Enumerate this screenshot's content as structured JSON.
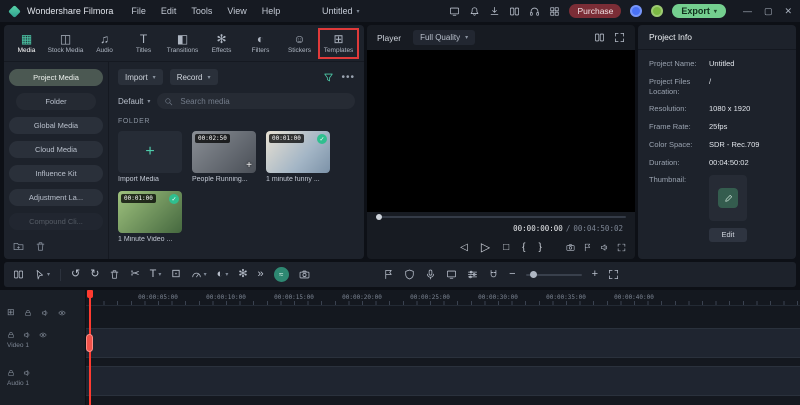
{
  "titlebar": {
    "app_name": "Wondershare Filmora",
    "menus": [
      "File",
      "Edit",
      "Tools",
      "View",
      "Help"
    ],
    "project_title": "Untitled",
    "purchase_label": "Purchase",
    "export_label": "Export"
  },
  "tabs": {
    "items": [
      {
        "label": "Media",
        "glyph": "▦"
      },
      {
        "label": "Stock Media",
        "glyph": "◫"
      },
      {
        "label": "Audio",
        "glyph": "♫"
      },
      {
        "label": "Titles",
        "glyph": "T"
      },
      {
        "label": "Transitions",
        "glyph": "◧"
      },
      {
        "label": "Effects",
        "glyph": "✻"
      },
      {
        "label": "Filters",
        "glyph": "◐"
      },
      {
        "label": "Stickers",
        "glyph": "☺"
      },
      {
        "label": "Templates",
        "glyph": "⊞"
      }
    ]
  },
  "sidebar": {
    "items": [
      {
        "label": "Project Media"
      },
      {
        "label": "Folder"
      },
      {
        "label": "Global Media"
      },
      {
        "label": "Cloud Media"
      },
      {
        "label": "Influence Kit"
      },
      {
        "label": "Adjustment La..."
      },
      {
        "label": "Compound Cli..."
      }
    ]
  },
  "media": {
    "import_label": "Import",
    "record_label": "Record",
    "sort_label": "Default",
    "search_placeholder": "Search media",
    "folder_label": "FOLDER",
    "tiles": [
      {
        "name": "Import Media"
      },
      {
        "name": "People Running...",
        "duration": "00:02:50"
      },
      {
        "name": "1 minute funny ...",
        "duration": "00:01:00"
      },
      {
        "name": "1 Minute Video ...",
        "duration": "00:01:00"
      }
    ]
  },
  "player": {
    "label": "Player",
    "quality": "Full Quality",
    "time_current": "00:00:00:00",
    "time_separator": "/",
    "time_total": "00:04:50:02"
  },
  "project_info": {
    "title": "Project Info",
    "fields": [
      {
        "label": "Project Name:",
        "value": "Untitled"
      },
      {
        "label": "Project Files Location:",
        "value": "/"
      },
      {
        "label": "Resolution:",
        "value": "1080 x 1920"
      },
      {
        "label": "Frame Rate:",
        "value": "25fps"
      },
      {
        "label": "Color Space:",
        "value": "SDR - Rec.709"
      },
      {
        "label": "Duration:",
        "value": "00:04:50:02"
      },
      {
        "label": "Thumbnail:",
        "value": ""
      }
    ],
    "edit_label": "Edit"
  },
  "timeline": {
    "ruler_labels": [
      "00:00:05:00",
      "00:00:10:00",
      "00:00:15:00",
      "00:00:20:00",
      "00:00:25:00",
      "00:00:30:00",
      "00:00:35:00",
      "00:00:40:00"
    ],
    "tracks": [
      {
        "name": "Video 1"
      },
      {
        "name": "Audio 1"
      }
    ]
  },
  "icons": {
    "chevron_down": "▾",
    "ellipsis": "•••",
    "plus": "+",
    "undo": "↺",
    "redo": "↻",
    "scissors": "✂",
    "text_tool": "T",
    "crop": "⊡",
    "color_wheel": "◐",
    "sparkle": "✻",
    "more_chevrons": "»",
    "wave": "≈",
    "minus": "−",
    "prev_frame": "◁",
    "play": "▷",
    "stop": "□",
    "mark_in": "{",
    "mark_out": "}",
    "check": "✓",
    "minimize": "—",
    "maximize": "▢",
    "close": "✕",
    "add_track": "⊞"
  },
  "colors": {
    "accent_teal": "#4ecdab",
    "export_green": "#74cf8f",
    "purchase_maroon": "#7b2d36",
    "annotation_red": "#e03a3a",
    "playhead_red": "#ff3b30"
  }
}
